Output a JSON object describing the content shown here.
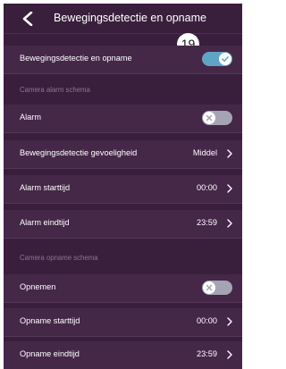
{
  "header": {
    "title": "Bewegingsdetectie en opname"
  },
  "badge": "19",
  "rows": {
    "motion": {
      "label": "Bewegingsdetectie en opname"
    },
    "alarm": {
      "label": "Alarm"
    },
    "sensitivity": {
      "label": "Bewegingsdetectie gevoeligheid",
      "value": "Middel"
    },
    "alarm_start": {
      "label": "Alarm starttijd",
      "value": "00:00"
    },
    "alarm_end": {
      "label": "Alarm eindtijd",
      "value": "23:59"
    },
    "record": {
      "label": "Opnemen"
    },
    "record_start": {
      "label": "Opname starttijd",
      "value": "00:00"
    },
    "record_end": {
      "label": "Opname eindtijd",
      "value": "23:59"
    }
  },
  "sections": {
    "alarm_schedule": "Camera alarm schema",
    "record_schedule": "Camera opname schema"
  },
  "toggles": {
    "motion": true,
    "alarm": false,
    "record": false
  },
  "colors": {
    "background": "#3a1f3d",
    "row": "#452748",
    "toggle_on": "#5fa4c4",
    "toggle_off": "#a4a4b4",
    "section_text": "#8e7591"
  },
  "icons": {
    "back": "chevron-left-icon",
    "row_arrow": "chevron-right-icon",
    "on": "check-icon",
    "off": "x-icon"
  }
}
